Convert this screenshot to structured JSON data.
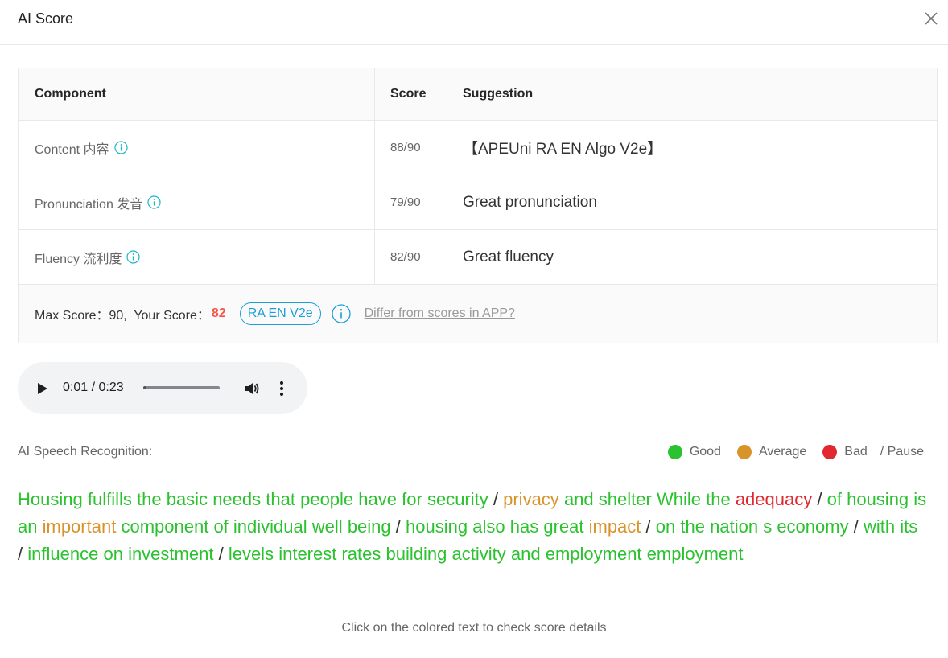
{
  "modal": {
    "title": "AI Score",
    "close_icon": "close-icon"
  },
  "table": {
    "headers": {
      "component": "Component",
      "score": "Score",
      "suggestion": "Suggestion"
    },
    "rows": [
      {
        "component": "Content 内容",
        "score": "88/90",
        "suggestion": "【APEUni RA EN Algo V2e】"
      },
      {
        "component": "Pronunciation 发音",
        "score": "79/90",
        "suggestion": "Great pronunciation"
      },
      {
        "component": "Fluency 流利度",
        "score": "82/90",
        "suggestion": "Great fluency"
      }
    ],
    "footer": {
      "max_score_text": "Max Score：90,  Your Score：",
      "your_score": "82",
      "algo_tag": "RA EN V2e",
      "differ_link": "Differ from scores in APP?"
    }
  },
  "player": {
    "current_time": "0:01",
    "duration": "0:23",
    "time_display": "0:01 / 0:23",
    "progress_fraction": 0.04
  },
  "recognition": {
    "label": "AI Speech Recognition:",
    "legend": {
      "good": "Good",
      "average": "Average",
      "bad": "Bad",
      "pause": "/ Pause"
    },
    "colors": {
      "good": "#2ac22e",
      "average": "#d8932a",
      "bad": "#e0282e"
    },
    "tokens": [
      {
        "t": "Housing",
        "s": "good"
      },
      {
        "t": "fulfills",
        "s": "good"
      },
      {
        "t": "the",
        "s": "good"
      },
      {
        "t": "basic",
        "s": "good"
      },
      {
        "t": "needs",
        "s": "good"
      },
      {
        "t": "that",
        "s": "good"
      },
      {
        "t": "people",
        "s": "good"
      },
      {
        "t": "have",
        "s": "good"
      },
      {
        "t": "for",
        "s": "good"
      },
      {
        "t": "security",
        "s": "good"
      },
      {
        "t": "/",
        "s": "pause"
      },
      {
        "t": "privacy",
        "s": "average"
      },
      {
        "t": "and",
        "s": "good"
      },
      {
        "t": "shelter",
        "s": "good"
      },
      {
        "t": "While",
        "s": "good"
      },
      {
        "t": "the",
        "s": "good"
      },
      {
        "t": "adequacy",
        "s": "bad"
      },
      {
        "t": "/",
        "s": "pause"
      },
      {
        "t": "of",
        "s": "good"
      },
      {
        "t": "housing",
        "s": "good"
      },
      {
        "t": "is",
        "s": "good"
      },
      {
        "t": "an",
        "s": "good"
      },
      {
        "t": "important",
        "s": "average"
      },
      {
        "t": "component",
        "s": "good"
      },
      {
        "t": "of",
        "s": "good"
      },
      {
        "t": "individual",
        "s": "good"
      },
      {
        "t": "well",
        "s": "good"
      },
      {
        "t": "being",
        "s": "good"
      },
      {
        "t": "/",
        "s": "pause"
      },
      {
        "t": "housing",
        "s": "good"
      },
      {
        "t": "also",
        "s": "good"
      },
      {
        "t": "has",
        "s": "good"
      },
      {
        "t": "great",
        "s": "good"
      },
      {
        "t": "impact",
        "s": "average"
      },
      {
        "t": "/",
        "s": "pause"
      },
      {
        "t": "on",
        "s": "good"
      },
      {
        "t": "the",
        "s": "good"
      },
      {
        "t": "nation",
        "s": "good"
      },
      {
        "t": "s",
        "s": "good"
      },
      {
        "t": "economy",
        "s": "good"
      },
      {
        "t": "/",
        "s": "pause"
      },
      {
        "t": "with",
        "s": "good"
      },
      {
        "t": "its",
        "s": "good"
      },
      {
        "t": "/",
        "s": "pause"
      },
      {
        "t": "influence",
        "s": "good"
      },
      {
        "t": "on",
        "s": "good"
      },
      {
        "t": "investment",
        "s": "good"
      },
      {
        "t": "/",
        "s": "pause"
      },
      {
        "t": "levels",
        "s": "good"
      },
      {
        "t": "interest",
        "s": "good"
      },
      {
        "t": "rates",
        "s": "good"
      },
      {
        "t": "building",
        "s": "good"
      },
      {
        "t": "activity",
        "s": "good"
      },
      {
        "t": "and",
        "s": "good"
      },
      {
        "t": "employment",
        "s": "good"
      },
      {
        "t": "employment",
        "s": "good"
      }
    ]
  },
  "hint": "Click on the colored text to check score details"
}
